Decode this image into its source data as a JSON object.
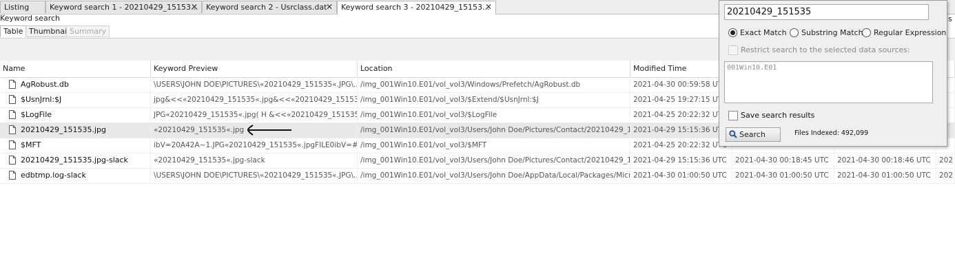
{
  "tabs": [
    {
      "label": "Listing",
      "closable": false
    },
    {
      "label": "Keyword search 1 - 20210429_15153...",
      "closable": true
    },
    {
      "label": "Keyword search 2 - Usrclass.dat",
      "closable": true
    },
    {
      "label": "Keyword search 3 - 20210429_15153...",
      "closable": true,
      "active": true
    }
  ],
  "close_glyph": "✕",
  "panel_title": "Keyword search",
  "right_edge_text": "s",
  "subtabs": {
    "table": "Table",
    "thumbnail": "Thumbnail",
    "summary": "Summary"
  },
  "columns": [
    "Name",
    "Keyword Preview",
    "Location",
    "Modified Time",
    "",
    "",
    ""
  ],
  "rows": [
    {
      "name": "AgRobust.db",
      "preview": "\\USERS\\JOHN DOE\\PICTURES\\«20210429_151535«.JPG\\...",
      "location": "/img_001Win10.E01/vol_vol3/Windows/Prefetch/AgRobust.db",
      "modified": "2021-04-30 00:59:58 UTC",
      "c5": "",
      "c6": "",
      "c7": ""
    },
    {
      "name": "$UsnJrnl:$J",
      "preview": "jpg&<<«20210429_151535«.jpg&<<«20210429_151535«.jp...",
      "location": "/img_001Win10.E01/vol_vol3/$Extend/$UsnJrnl:$J",
      "modified": "2021-04-25 19:27:15 UTC",
      "c5": "",
      "c6": "",
      "c7": ""
    },
    {
      "name": "$LogFile",
      "preview": "JPG«20210429_151535«.jpg( H &<<«20210429_151535«.jpg",
      "location": "/img_001Win10.E01/vol_vol3/$LogFile",
      "modified": "2021-04-25 20:22:32 UTC",
      "c5": "",
      "c6": "",
      "c7": ""
    },
    {
      "name": "20210429_151535.jpg",
      "preview": "«20210429_151535«.jpg",
      "location": "/img_001Win10.E01/vol_vol3/Users/John Doe/Pictures/Contact/20210429_151...",
      "modified": "2021-04-29 15:15:36 UTC",
      "c5": "",
      "c6": "",
      "c7": "",
      "selected": true
    },
    {
      "name": "$MFT",
      "preview": "ibV=20A42A~1.JPG«20210429_151535«.jpgFILE0ibV=#ZV=",
      "location": "/img_001Win10.E01/vol_vol3/$MFT",
      "modified": "2021-04-25 20:22:32 UTC",
      "c5": "",
      "c6": "",
      "c7": ""
    },
    {
      "name": "20210429_151535.jpg-slack",
      "preview": "«20210429_151535«.jpg-slack",
      "location": "/img_001Win10.E01/vol_vol3/Users/John Doe/Pictures/Contact/20210429_151...",
      "modified": "2021-04-29 15:15:36 UTC",
      "c5": "2021-04-30 00:18:45 UTC",
      "c6": "2021-04-30 00:18:46 UTC",
      "c7": "202"
    },
    {
      "name": "edbtmp.log-slack",
      "preview": "\\USERS\\JOHN DOE\\PICTURES\\«20210429_151535«.JPG\\...",
      "location": "/img_001Win10.E01/vol_vol3/Users/John Doe/AppData/Local/Packages/Micros...",
      "modified": "2021-04-30 01:00:50 UTC",
      "c5": "2021-04-30 01:00:50 UTC",
      "c6": "2021-04-30 01:00:50 UTC",
      "c7": "202"
    }
  ],
  "search_popup": {
    "query": "20210429_151535",
    "options": [
      {
        "label": "Exact Match",
        "selected": true
      },
      {
        "label": "Substring Match",
        "selected": false
      },
      {
        "label": "Regular Expression",
        "selected": false
      }
    ],
    "restrict_label": "Restrict search to the selected data sources:",
    "data_sources": [
      "001Win10.E01"
    ],
    "save_label": "Save search results",
    "search_button": "Search",
    "files_indexed": "Files Indexed: 492,099"
  }
}
